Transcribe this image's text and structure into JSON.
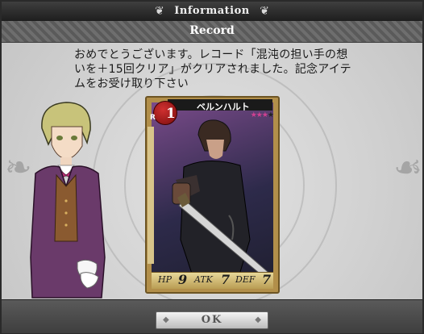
{
  "window": {
    "title": "Information",
    "title_ornament": "❦"
  },
  "section": {
    "title": "Record"
  },
  "message": "おめでとうございます。レコード「混沌の担い手の想いを＋15回クリア」がクリアされました。記念アイテムをお受け取り下さい",
  "card": {
    "rank_letter": "R",
    "rank_number": "1",
    "name": "ベルンハルト",
    "sub_label": "BERNE",
    "stars": "★★★★",
    "stars_filled": 3,
    "stats": {
      "hp_label": "HP",
      "hp": "9",
      "atk_label": "ATK",
      "atk": "7",
      "def_label": "DEF",
      "def": "7"
    }
  },
  "ok_button": {
    "label": "OK"
  },
  "colors": {
    "accent_red": "#c02020",
    "star_pink": "#d04090",
    "gold": "#b28f4a"
  }
}
